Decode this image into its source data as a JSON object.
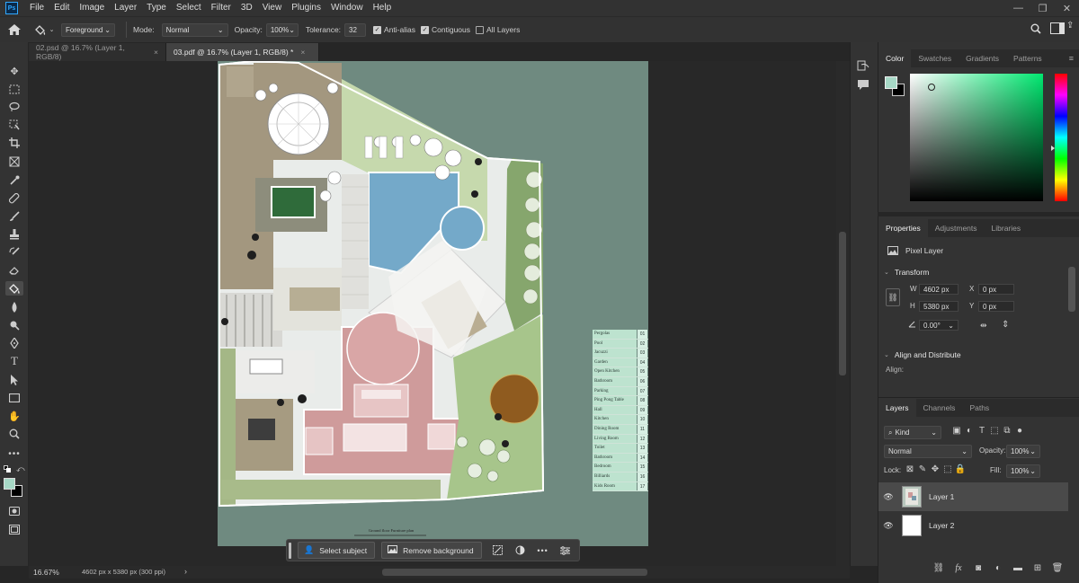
{
  "app": {
    "logo": "Ps",
    "menu": [
      "File",
      "Edit",
      "Image",
      "Layer",
      "Type",
      "Select",
      "Filter",
      "3D",
      "View",
      "Plugins",
      "Window",
      "Help"
    ]
  },
  "options": {
    "fill_source": "Foreground",
    "mode_label": "Mode:",
    "mode_value": "Normal",
    "opacity_label": "Opacity:",
    "opacity_value": "100%",
    "tolerance_label": "Tolerance:",
    "tolerance_value": "32",
    "antialias_label": "Anti-alias",
    "contiguous_label": "Contiguous",
    "all_layers_label": "All Layers"
  },
  "tabs": [
    {
      "label": "02.psd @ 16.7% (Layer 1, RGB/8)",
      "active": false
    },
    {
      "label": "03.pdf @ 16.7% (Layer 1, RGB/8) *",
      "active": true
    }
  ],
  "canvas": {
    "bg_color": "#6f8a80",
    "caption": "Ground floor Furniture plan",
    "legend": [
      {
        "name": "Pergolas",
        "num": "01"
      },
      {
        "name": "Pool",
        "num": "02"
      },
      {
        "name": "Jacuzzi",
        "num": "03"
      },
      {
        "name": "Garden",
        "num": "04"
      },
      {
        "name": "Open Kitchen",
        "num": "05"
      },
      {
        "name": "Bathroom",
        "num": "06"
      },
      {
        "name": "Parking",
        "num": "07"
      },
      {
        "name": "Ping Pong Table",
        "num": "08"
      },
      {
        "name": "Hall",
        "num": "09"
      },
      {
        "name": "Kitchen",
        "num": "10"
      },
      {
        "name": "Dining Room",
        "num": "11"
      },
      {
        "name": "Living Room",
        "num": "12"
      },
      {
        "name": "Toilet",
        "num": "13"
      },
      {
        "name": "Bathroom",
        "num": "14"
      },
      {
        "name": "Bedroom",
        "num": "15"
      },
      {
        "name": "Billiards",
        "num": "16"
      },
      {
        "name": "Kids Room",
        "num": "17"
      }
    ]
  },
  "taskbar": {
    "select_subject": "Select subject",
    "remove_background": "Remove background"
  },
  "status": {
    "zoom": "16.67%",
    "dimensions": "4602 px x 5380 px (300 ppi)"
  },
  "color_panel": {
    "tabs": [
      "Color",
      "Swatches",
      "Gradients",
      "Patterns"
    ],
    "foreground": "#a7d8c6",
    "background": "#000000"
  },
  "properties": {
    "tabs": [
      "Properties",
      "Adjustments",
      "Libraries"
    ],
    "layer_type": "Pixel Layer",
    "transform_title": "Transform",
    "w_label": "W",
    "w_value": "4602 px",
    "h_label": "H",
    "h_value": "5380 px",
    "x_label": "X",
    "x_value": "0 px",
    "y_label": "Y",
    "y_value": "0 px",
    "angle_value": "0.00°",
    "align_title": "Align and Distribute",
    "align_label": "Align:"
  },
  "layers": {
    "tabs": [
      "Layers",
      "Channels",
      "Paths"
    ],
    "kind_label": "Kind",
    "blend_mode": "Normal",
    "opacity_label": "Opacity:",
    "opacity_value": "100%",
    "lock_label": "Lock:",
    "fill_label": "Fill:",
    "fill_value": "100%",
    "items": [
      {
        "name": "Layer 1",
        "selected": true
      },
      {
        "name": "Layer 2",
        "selected": false
      }
    ]
  }
}
